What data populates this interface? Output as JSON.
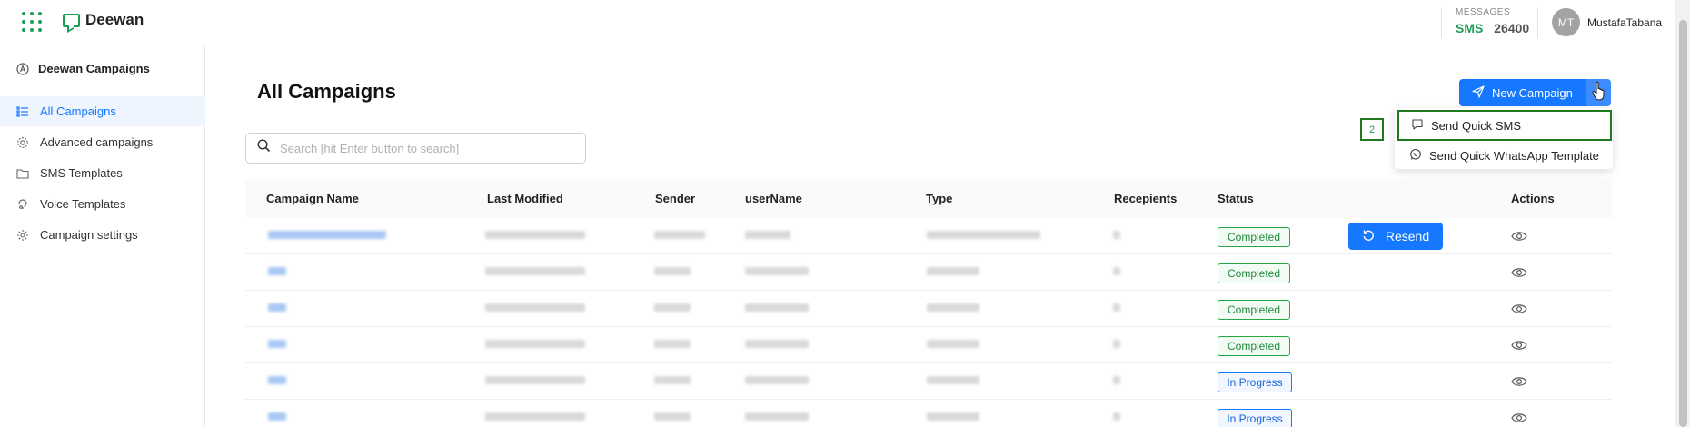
{
  "header": {
    "brand": "Deewan",
    "messages_label": "MESSAGES",
    "sms_label": "SMS",
    "sms_count": "26400",
    "avatar_initials": "MT",
    "username": "MustafaTabana"
  },
  "sidebar": {
    "title": "Deewan Campaigns",
    "items": [
      {
        "label": "All Campaigns",
        "icon": "list-icon",
        "active": true
      },
      {
        "label": "Advanced campaigns",
        "icon": "settings-gear-icon",
        "active": false
      },
      {
        "label": "SMS Templates",
        "icon": "folder-icon",
        "active": false
      },
      {
        "label": "Voice Templates",
        "icon": "voice-icon",
        "active": false
      },
      {
        "label": "Campaign settings",
        "icon": "gear-icon",
        "active": false
      }
    ]
  },
  "main": {
    "title": "All Campaigns",
    "search_placeholder": "Search [hit Enter button to search]",
    "new_campaign_label": "New Campaign",
    "step_badge": "2",
    "dropdown": [
      {
        "label": "Send Quick SMS",
        "icon": "chat-icon"
      },
      {
        "label": "Send Quick WhatsApp Template",
        "icon": "whatsapp-icon"
      }
    ]
  },
  "table": {
    "columns": [
      "Campaign Name",
      "Last Modified",
      "Sender",
      "userName",
      "Type",
      "Recepients",
      "Status",
      "Actions"
    ],
    "rows": [
      {
        "status": "Completed",
        "status_kind": "completed",
        "resend": true
      },
      {
        "status": "Completed",
        "status_kind": "completed",
        "resend": false
      },
      {
        "status": "Completed",
        "status_kind": "completed",
        "resend": false
      },
      {
        "status": "Completed",
        "status_kind": "completed",
        "resend": false
      },
      {
        "status": "In Progress",
        "status_kind": "progress",
        "resend": false
      },
      {
        "status": "In Progress",
        "status_kind": "progress",
        "resend": false
      }
    ],
    "resend_label": "Resend"
  },
  "colors": {
    "brand_green": "#1f9d55",
    "primary_blue": "#1677ff",
    "completed_green": "#28a745",
    "highlight_green": "#1f7a1f"
  }
}
